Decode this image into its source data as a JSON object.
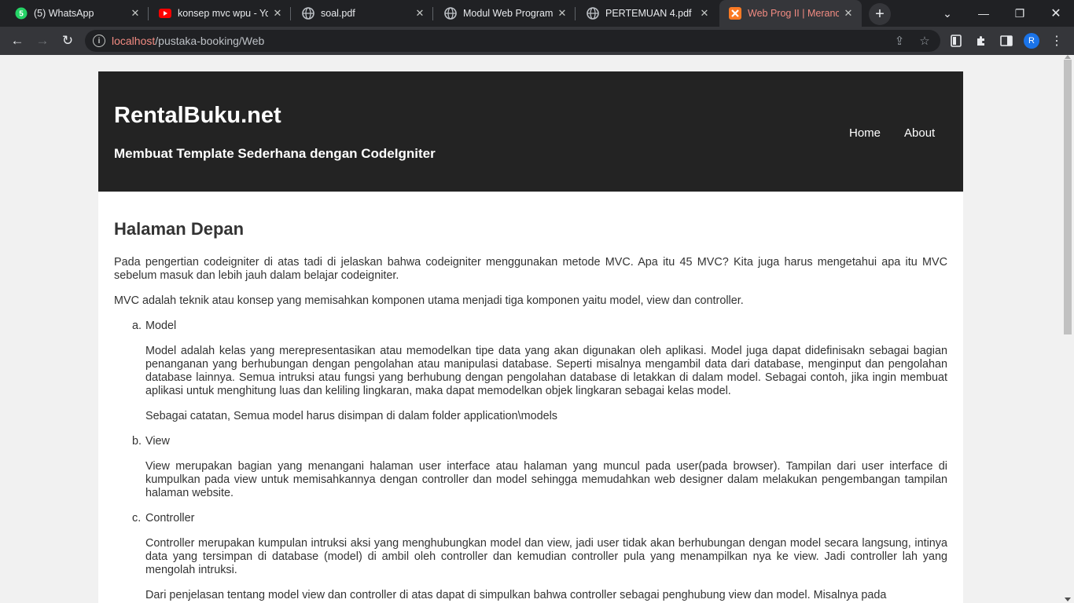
{
  "browser": {
    "tabs": [
      {
        "title": "(5) WhatsApp"
      },
      {
        "title": "konsep mvc wpu - YouTube"
      },
      {
        "title": "soal.pdf"
      },
      {
        "title": "Modul Web Programming"
      },
      {
        "title": "PERTEMUAN 4.pdf"
      },
      {
        "title": "Web Prog II | Merancang"
      }
    ],
    "url_host": "localhost",
    "url_path": "/pustaka-booking/Web",
    "profile_initial": "R",
    "accent": "#f28b82"
  },
  "site": {
    "logo": "RentalBuku.net",
    "tagline": "Membuat Template Sederhana dengan CodeIgniter",
    "nav": [
      "Home",
      "About"
    ]
  },
  "content": {
    "heading": "Halaman Depan",
    "intro": "Pada pengertian codeigniter di atas tadi di jelaskan bahwa codeigniter menggunakan metode MVC. Apa itu 45 MVC? Kita juga harus mengetahui apa itu MVC sebelum masuk dan lebih jauh dalam belajar codeigniter.",
    "mvc_def": "MVC adalah teknik atau konsep yang memisahkan komponen utama menjadi tiga komponen yaitu model, view dan controller.",
    "items": [
      {
        "marker": "a.",
        "name": "Model",
        "paras": [
          "Model adalah kelas yang merepresentasikan atau memodelkan tipe data yang akan digunakan oleh aplikasi. Model juga dapat didefinisakn sebagai bagian penanganan yang berhubungan dengan pengolahan atau manipulasi database. Seperti misalnya mengambil data dari database, menginput dan pengolahan database lainnya. Semua intruksi atau fungsi yang berhubung dengan pengolahan database di letakkan di dalam model. Sebagai contoh, jika ingin membuat aplikasi untuk menghitung luas dan keliling lingkaran, maka dapat memodelkan objek lingkaran sebagai kelas model.",
          "Sebagai catatan, Semua model harus disimpan di dalam folder application\\models"
        ]
      },
      {
        "marker": "b.",
        "name": "View",
        "paras": [
          "View merupakan bagian yang menangani halaman user interface atau halaman yang muncul pada user(pada browser). Tampilan dari user interface di kumpulkan pada view untuk memisahkannya dengan controller dan model sehingga memudahkan web designer dalam melakukan pengembangan tampilan halaman website."
        ]
      },
      {
        "marker": "c.",
        "name": "Controller",
        "paras": [
          "Controller merupakan kumpulan intruksi aksi yang menghubungkan model dan view, jadi user tidak akan berhubungan dengan model secara langsung, intinya data yang tersimpan di database (model) di ambil oleh controller dan kemudian controller pula yang menampilkan nya ke view. Jadi controller lah yang mengolah intruksi.",
          "Dari penjelasan tentang model view dan controller di atas dapat di simpulkan bahwa controller sebagai penghubung view dan model. Misalnya pada"
        ]
      }
    ]
  }
}
